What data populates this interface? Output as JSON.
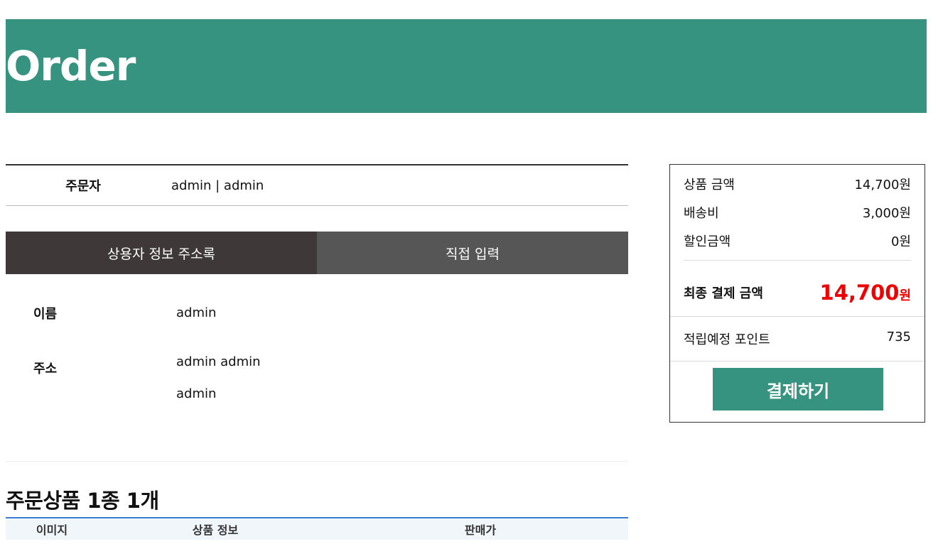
{
  "header": {
    "title": "Order"
  },
  "orderer": {
    "label": "주문자",
    "value": "admin | admin"
  },
  "address_tabs": [
    {
      "label": "상용자 정보 주소록"
    },
    {
      "label": "직접 입력"
    }
  ],
  "recipient": {
    "name_label": "이름",
    "name_value": "admin",
    "address_label": "주소",
    "address_line1": "admin admin",
    "address_line2": "admin"
  },
  "products": {
    "title": "주문상품 1종 1개",
    "columns": [
      "이미지",
      "상품 정보",
      "판매가"
    ]
  },
  "summary": {
    "product_amount_label": "상품 금액",
    "product_amount": "14,700원",
    "shipping_label": "배송비",
    "shipping": "3,000원",
    "discount_label": "할인금액",
    "discount": "0원",
    "final_label": "최종 결제 금액",
    "final_amount": "14,700",
    "final_unit": "원",
    "points_label": "적립예정 포인트",
    "points": "735",
    "pay_button": "결제하기"
  },
  "colors": {
    "brand": "#359380",
    "tab_active": "#3e3938",
    "tab_inactive": "#575656",
    "final_amount": "#f20000"
  }
}
